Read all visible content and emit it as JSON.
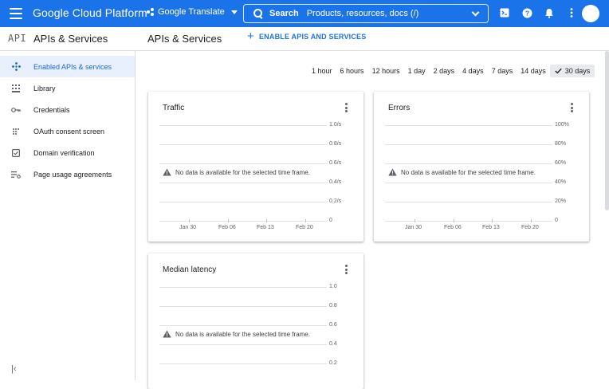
{
  "topbar": {
    "brand": "Google Cloud Platform",
    "project": "Google Translate",
    "search_label": "Search",
    "search_placeholder": "Products, resources, docs (/)"
  },
  "subheader": {
    "logo": "API",
    "section_title": "APIs & Services",
    "page_title": "APIs & Services",
    "enable_button": "ENABLE APIS AND SERVICES"
  },
  "sidebar": {
    "items": [
      {
        "label": "Enabled APIs & services",
        "icon": "diamond-dots-icon",
        "active": true
      },
      {
        "label": "Library",
        "icon": "library-grid-icon",
        "active": false
      },
      {
        "label": "Credentials",
        "icon": "key-icon",
        "active": false
      },
      {
        "label": "OAuth consent screen",
        "icon": "oauth-dots-icon",
        "active": false
      },
      {
        "label": "Domain verification",
        "icon": "checkbox-icon",
        "active": false
      },
      {
        "label": "Page usage agreements",
        "icon": "settings-list-icon",
        "active": false
      }
    ],
    "collapse_icon": "collapse-left-icon"
  },
  "time_ranges": [
    "1 hour",
    "6 hours",
    "12 hours",
    "1 day",
    "2 days",
    "4 days",
    "7 days",
    "14 days",
    "30 days"
  ],
  "selected_range": "30 days",
  "cards": {
    "traffic": {
      "title": "Traffic",
      "y_ticks": [
        "1.0/s",
        "0.8/s",
        "0.6/s",
        "0.4/s",
        "0.2/s",
        "0"
      ],
      "x_ticks": [
        "Jan 30",
        "Feb 06",
        "Feb 13",
        "Feb 20"
      ],
      "message": "No data is available for the selected time frame."
    },
    "errors": {
      "title": "Errors",
      "y_ticks": [
        "100%",
        "80%",
        "60%",
        "40%",
        "20%",
        "0"
      ],
      "x_ticks": [
        "Jan 30",
        "Feb 06",
        "Feb 13",
        "Feb 20"
      ],
      "message": "No data is available for the selected time frame."
    },
    "latency": {
      "title": "Median latency",
      "y_ticks": [
        "1.0",
        "0.8",
        "0.6",
        "0.4",
        "0.2"
      ],
      "message": "No data is available for the selected time frame."
    }
  },
  "colors": {
    "brand_blue": "#1a73e8",
    "active_bg": "#e8f0fe",
    "active_text": "#1967d2"
  }
}
